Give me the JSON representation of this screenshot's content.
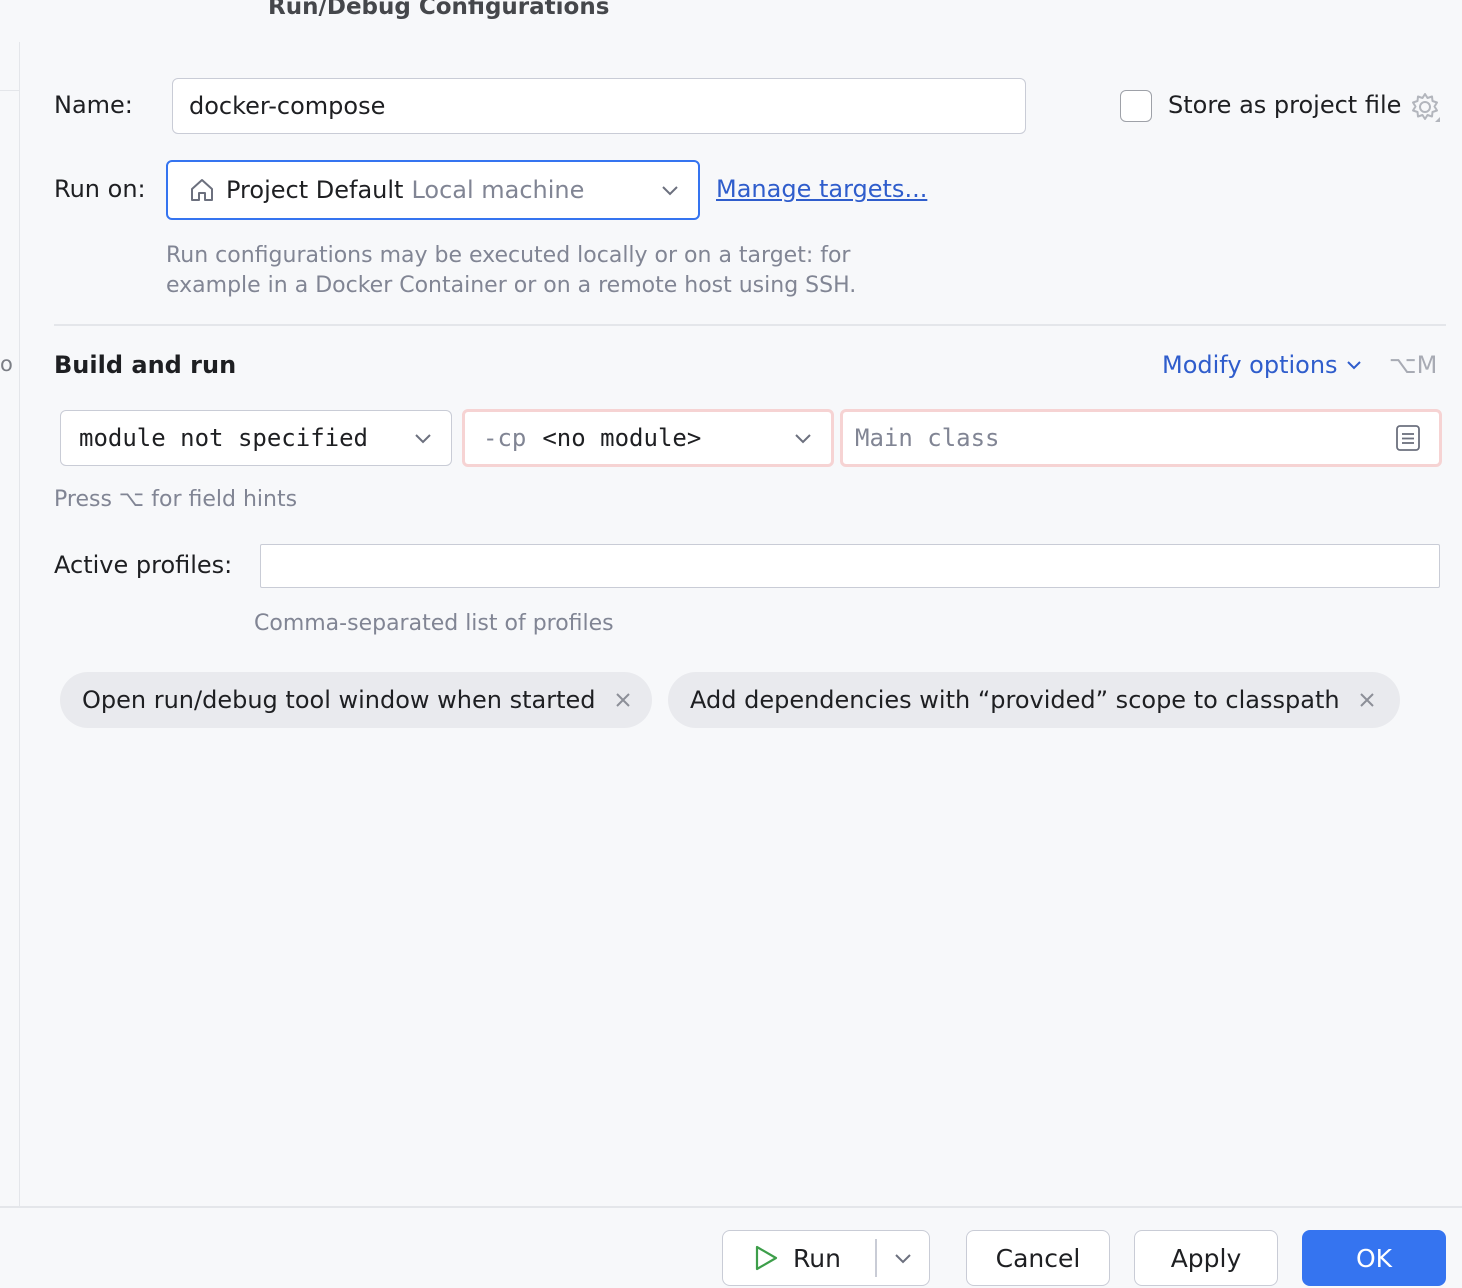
{
  "window": {
    "title": "Run/Debug Configurations",
    "sidebar_clip_text": "o"
  },
  "name_row": {
    "label": "Name:",
    "value": "docker-compose",
    "store_label": "Store as project file"
  },
  "run_on": {
    "label": "Run on:",
    "selected_primary": "Project Default",
    "selected_secondary": "Local machine",
    "manage_link": "Manage targets...",
    "hint_line1": "Run configurations may be executed locally or on a target: for",
    "hint_line2": "example in a Docker Container or on a remote host using SSH."
  },
  "build_and_run": {
    "title": "Build and run",
    "modify_options": "Modify options",
    "modify_shortcut": "⌥M",
    "jdk_value": "module not specified",
    "cp_prefix": "-cp",
    "cp_value": "<no module>",
    "main_class_placeholder": "Main class",
    "field_hint": "Press ⌥ for field hints"
  },
  "profiles": {
    "label": "Active profiles:",
    "value": "",
    "hint": "Comma-separated list of profiles"
  },
  "chips": [
    {
      "label": "Open run/debug tool window when started"
    },
    {
      "label": "Add dependencies with “provided” scope to classpath"
    }
  ],
  "footer": {
    "run": "Run",
    "cancel": "Cancel",
    "apply": "Apply",
    "ok": "OK"
  },
  "colors": {
    "accent": "#3574f0",
    "link": "#2f5dcc",
    "error_border": "#f6d3d3",
    "run_icon": "#3d9e4a"
  }
}
